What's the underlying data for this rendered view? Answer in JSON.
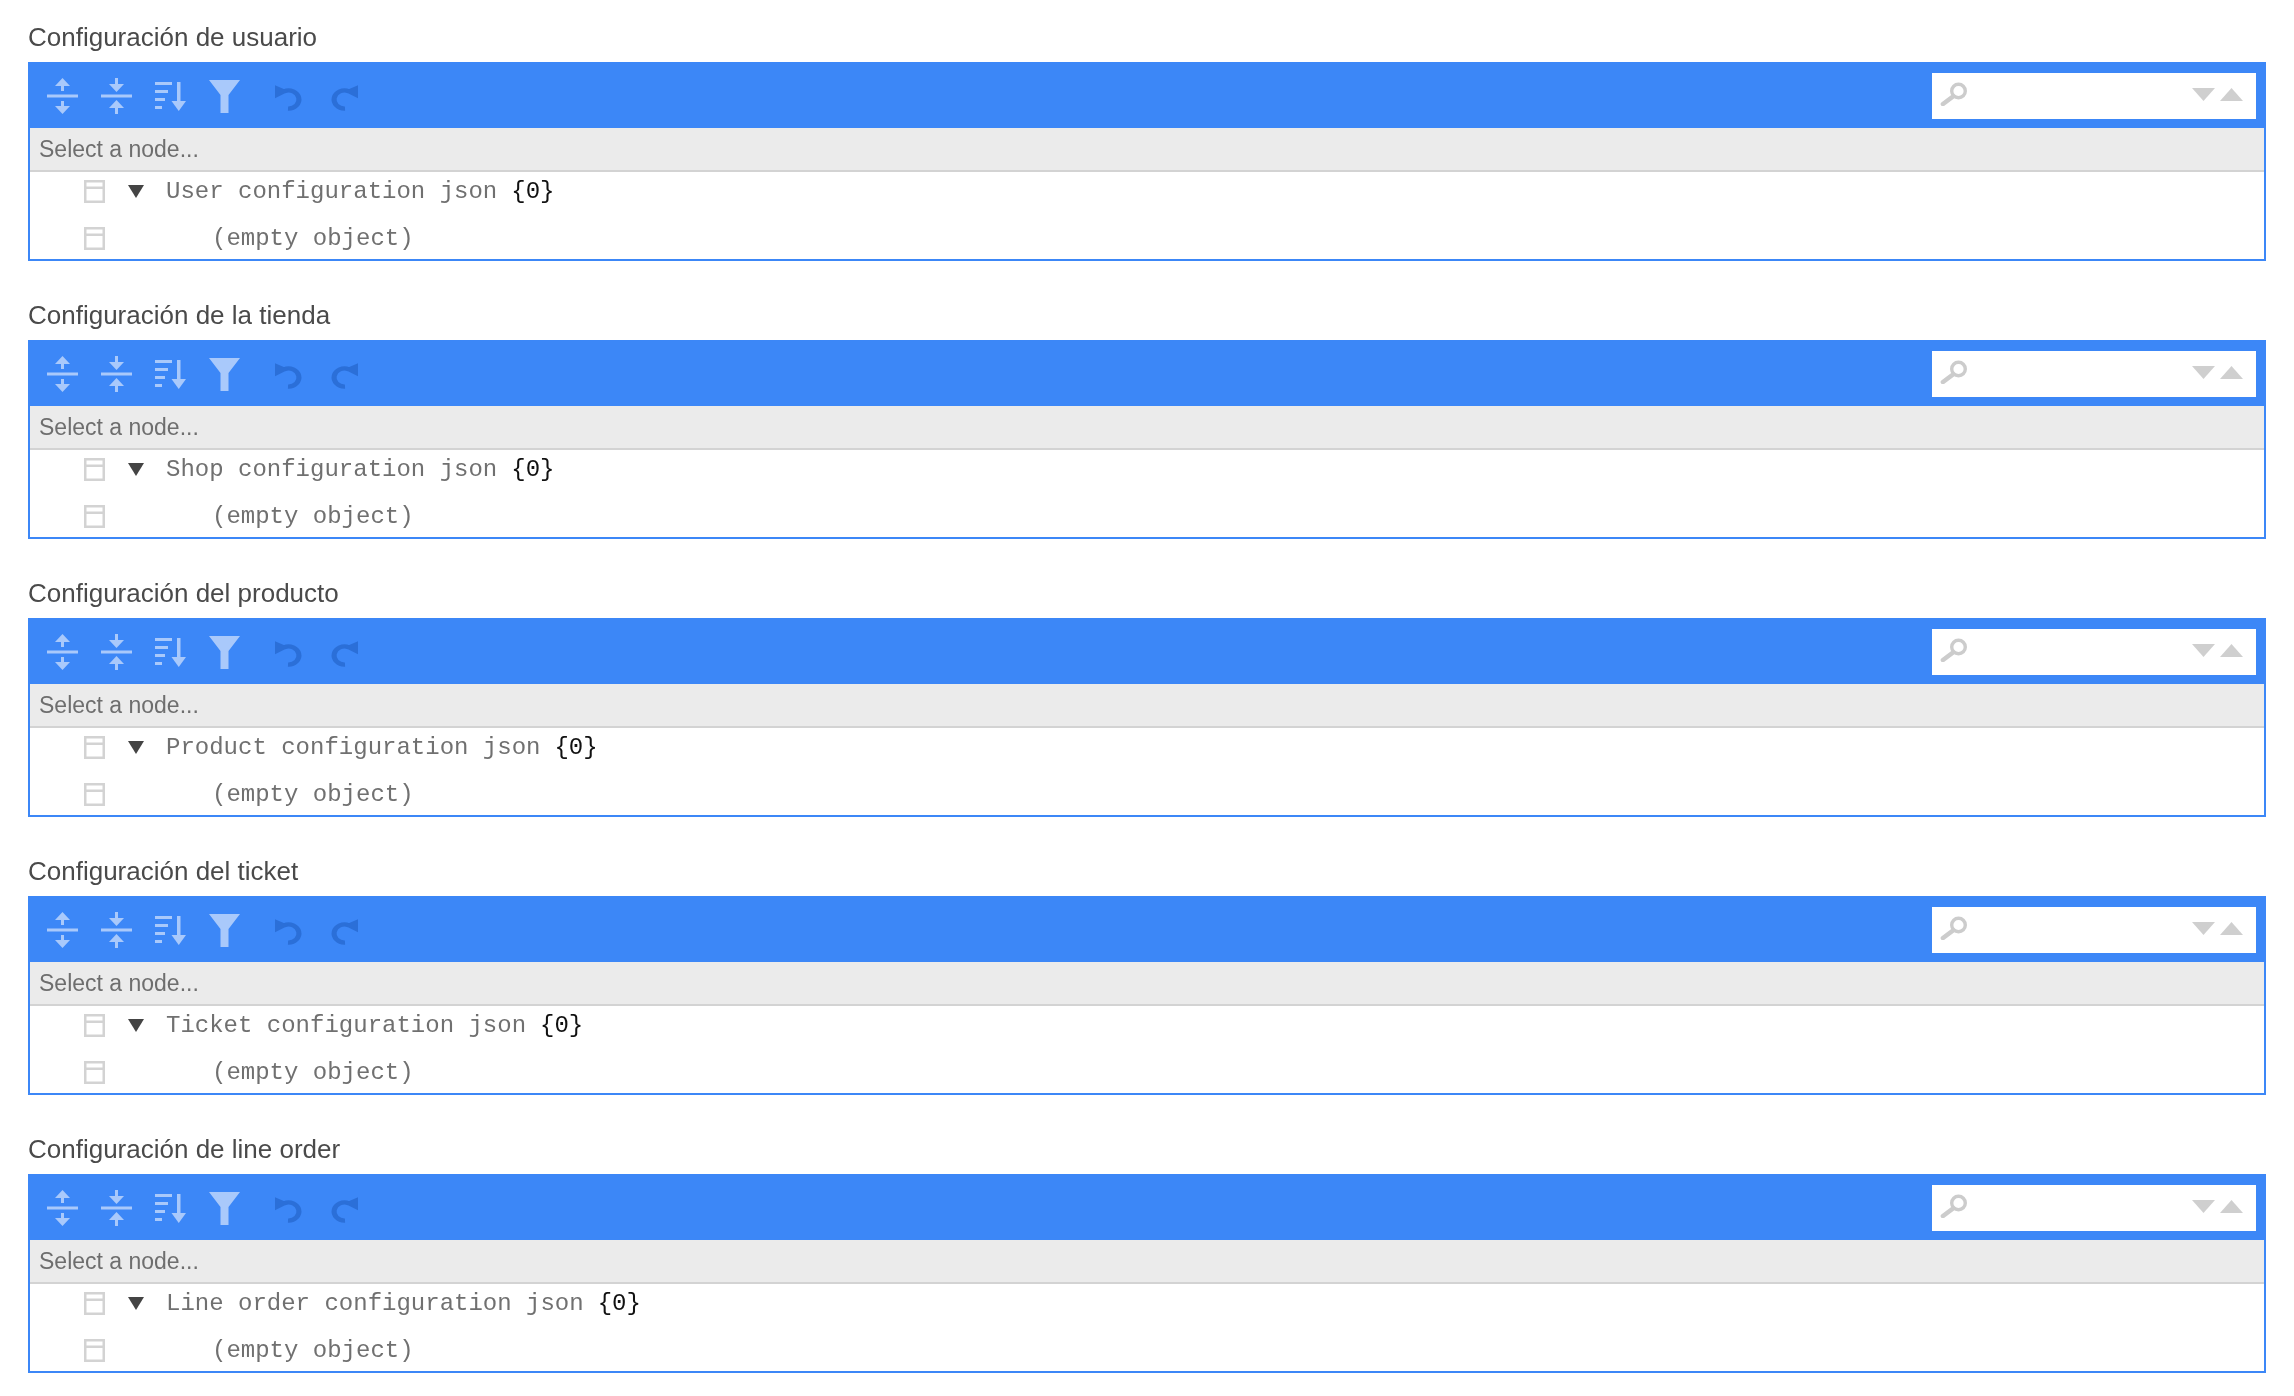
{
  "sections": [
    {
      "title": "Configuración de usuario",
      "editor": {
        "toolbar": [
          {
            "kind": "expand_all",
            "disabled": false
          },
          {
            "kind": "collapse_all",
            "disabled": false
          },
          {
            "kind": "sort",
            "disabled": false
          },
          {
            "kind": "filter",
            "disabled": false
          },
          {
            "kind": "undo",
            "disabled": true
          },
          {
            "kind": "redo",
            "disabled": true
          }
        ],
        "navigation": "Select a node...",
        "tree": [
          {
            "kind": "object",
            "key": "User configuration json",
            "summary": "{0}",
            "expanded": true,
            "children": [
              {
                "kind": "empty",
                "label": "(empty object)"
              }
            ]
          }
        ]
      }
    },
    {
      "title": "Configuración de la tienda",
      "editor": {
        "toolbar": [
          {
            "kind": "expand_all",
            "disabled": false
          },
          {
            "kind": "collapse_all",
            "disabled": false
          },
          {
            "kind": "sort",
            "disabled": false
          },
          {
            "kind": "filter",
            "disabled": false
          },
          {
            "kind": "undo",
            "disabled": true
          },
          {
            "kind": "redo",
            "disabled": true
          }
        ],
        "navigation": "Select a node...",
        "tree": [
          {
            "kind": "object",
            "key": "Shop configuration json",
            "summary": "{0}",
            "expanded": true,
            "children": [
              {
                "kind": "empty",
                "label": "(empty object)"
              }
            ]
          }
        ]
      }
    },
    {
      "title": "Configuración del producto",
      "editor": {
        "toolbar": [
          {
            "kind": "expand_all",
            "disabled": false
          },
          {
            "kind": "collapse_all",
            "disabled": false
          },
          {
            "kind": "sort",
            "disabled": false
          },
          {
            "kind": "filter",
            "disabled": false
          },
          {
            "kind": "undo",
            "disabled": true
          },
          {
            "kind": "redo",
            "disabled": true
          }
        ],
        "navigation": "Select a node...",
        "tree": [
          {
            "kind": "object",
            "key": "Product configuration json",
            "summary": "{0}",
            "expanded": true,
            "children": [
              {
                "kind": "empty",
                "label": "(empty object)"
              }
            ]
          }
        ]
      }
    },
    {
      "title": "Configuración del ticket",
      "editor": {
        "toolbar": [
          {
            "kind": "expand_all",
            "disabled": false
          },
          {
            "kind": "collapse_all",
            "disabled": false
          },
          {
            "kind": "sort",
            "disabled": false
          },
          {
            "kind": "filter",
            "disabled": false
          },
          {
            "kind": "undo",
            "disabled": true
          },
          {
            "kind": "redo",
            "disabled": true
          }
        ],
        "navigation": "Select a node...",
        "tree": [
          {
            "kind": "object",
            "key": "Ticket configuration json",
            "summary": "{0}",
            "expanded": true,
            "children": [
              {
                "kind": "empty",
                "label": "(empty object)"
              }
            ]
          }
        ]
      }
    },
    {
      "title": "Configuración de line order",
      "editor": {
        "toolbar": [
          {
            "kind": "expand_all",
            "disabled": false
          },
          {
            "kind": "collapse_all",
            "disabled": false
          },
          {
            "kind": "sort",
            "disabled": false
          },
          {
            "kind": "filter",
            "disabled": false
          },
          {
            "kind": "undo",
            "disabled": true
          },
          {
            "kind": "redo",
            "disabled": true
          }
        ],
        "navigation": "Select a node...",
        "tree": [
          {
            "kind": "object",
            "key": "Line order configuration json",
            "summary": "{0}",
            "expanded": true,
            "children": [
              {
                "kind": "empty",
                "label": "(empty object)"
              }
            ]
          }
        ]
      }
    }
  ]
}
